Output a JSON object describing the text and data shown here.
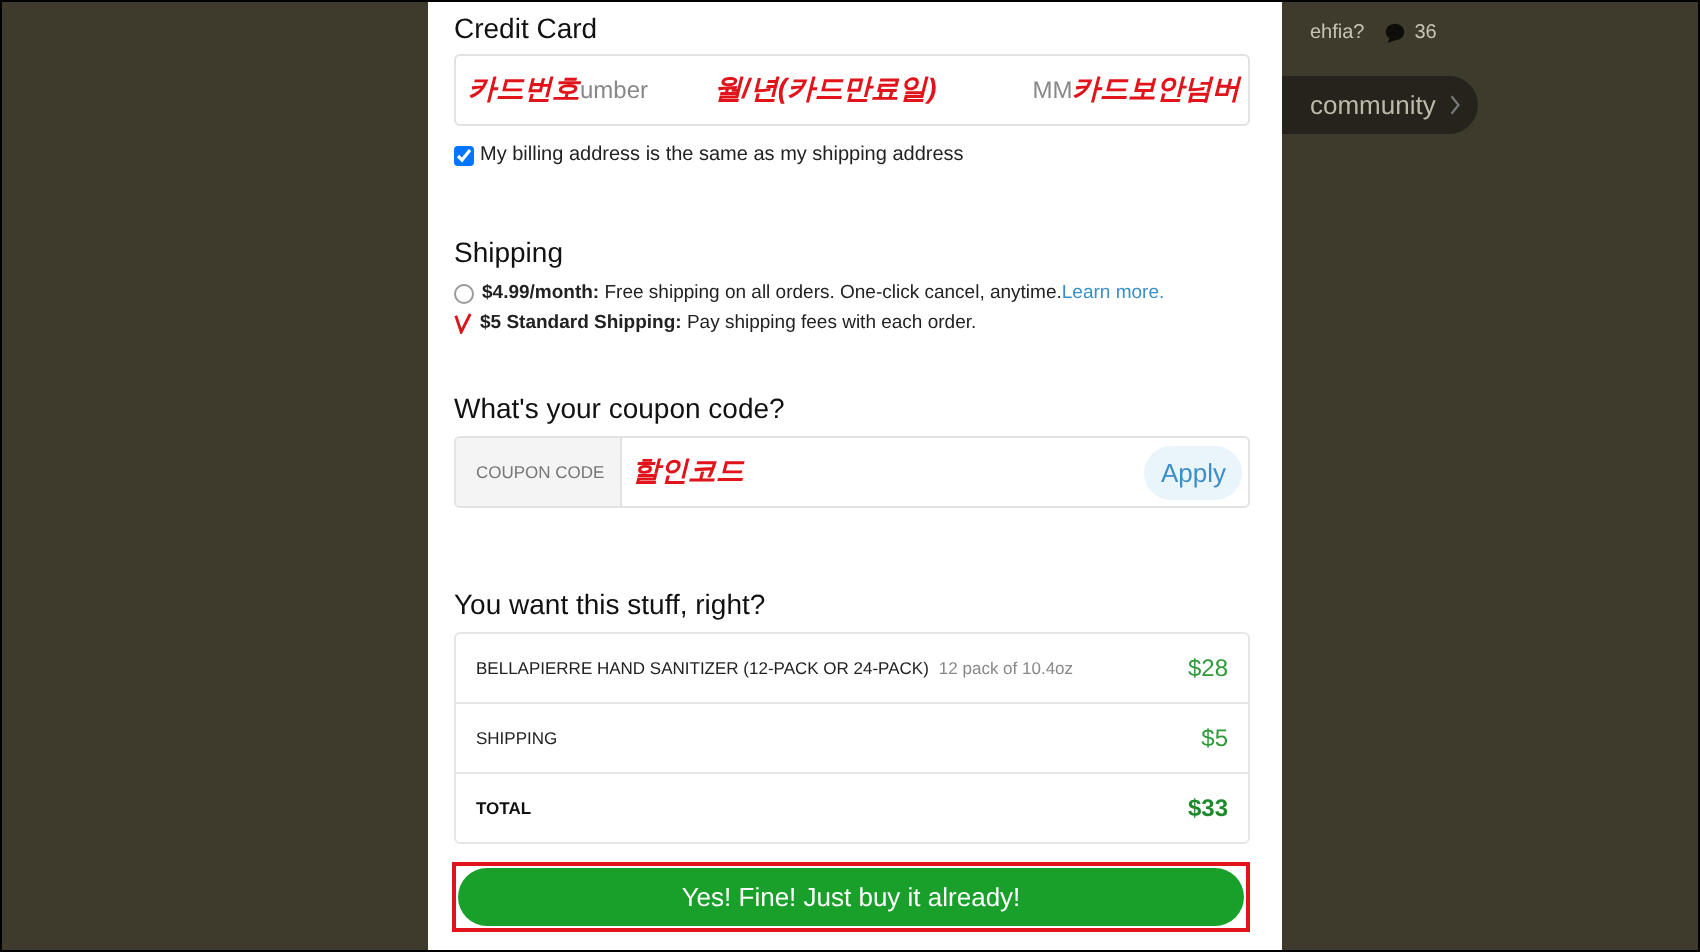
{
  "credit_card": {
    "heading": "Credit Card",
    "number_annotation": "카드번호",
    "number_placeholder": "umber",
    "expiry_annotation": "월/년(카드만료일)",
    "cvc_placeholder": "MM",
    "cvc_annotation": "카드보안넘버"
  },
  "billing": {
    "label": "My billing address is the same as my shipping address",
    "checked": true
  },
  "shipping": {
    "heading": "Shipping",
    "options": [
      {
        "text": "**$4.99/month:** Free shipping on all orders. One-click cancel, anytime.",
        "link": "Learn more.",
        "selected": false
      },
      {
        "text": "**$5 Standard Shipping:** Pay shipping fees with each order.",
        "selected": true
      }
    ]
  },
  "coupon": {
    "heading": "What's your coupon code?",
    "label": "COUPON CODE",
    "annotation": "할인코드",
    "button": "Apply"
  },
  "order": {
    "heading": "You want this stuff, right?",
    "rows": [
      {
        "kind": "item",
        "name": "BELLAPIERRE HAND SANITIZER (12-PACK OR 24-PACK)",
        "detail": "12 pack of 10.4oz",
        "price": "$28"
      },
      {
        "kind": "item",
        "name": "SHIPPING",
        "price": "$5"
      },
      {
        "kind": "total",
        "name": "TOTAL",
        "price": "$33"
      }
    ]
  },
  "buy_button": {
    "label": "Yes! Fine! Just buy it already!",
    "highlighted": true
  },
  "background": {
    "question": "ehfia?",
    "comment_count": "36",
    "community_button": "community"
  }
}
